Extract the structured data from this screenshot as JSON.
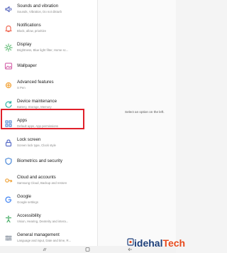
{
  "settings": {
    "items": [
      {
        "title": "Sounds and vibration",
        "subtitle": "Sounds, Vibration, Do not disturb",
        "icon": "speaker-icon",
        "color": "#5c6bc0"
      },
      {
        "title": "Notifications",
        "subtitle": "Block, allow, prioritize",
        "icon": "bell-icon",
        "color": "#ef6c57"
      },
      {
        "title": "Display",
        "subtitle": "Brightness, Blue light filter, Home sc...",
        "icon": "sun-icon",
        "color": "#58b86e"
      },
      {
        "title": "Wallpaper",
        "subtitle": "",
        "icon": "image-icon",
        "color": "#d86fb0"
      },
      {
        "title": "Advanced features",
        "subtitle": "S Pen",
        "icon": "gear-plus-icon",
        "color": "#f2a33a"
      },
      {
        "title": "Device maintenance",
        "subtitle": "Battery, Storage, Memory",
        "icon": "refresh-icon",
        "color": "#35b6a8"
      },
      {
        "title": "Apps",
        "subtitle": "Default apps, App permissions",
        "icon": "apps-grid-icon",
        "color": "#5c8fd6"
      },
      {
        "title": "Lock screen",
        "subtitle": "Screen lock type, Clock style",
        "icon": "lock-icon",
        "color": "#5a6ec7"
      },
      {
        "title": "Biometrics and security",
        "subtitle": "",
        "icon": "shield-icon",
        "color": "#4a88d8"
      },
      {
        "title": "Cloud and accounts",
        "subtitle": "Samsung Cloud, Backup and restore",
        "icon": "key-icon",
        "color": "#f0a43b"
      },
      {
        "title": "Google",
        "subtitle": "Google settings",
        "icon": "google-icon",
        "color": "#4285f4"
      },
      {
        "title": "Accessibility",
        "subtitle": "Vision, Hearing, Dexterity and intera...",
        "icon": "accessibility-icon",
        "color": "#4caf6a"
      },
      {
        "title": "General management",
        "subtitle": "Language and input, Date and time, R...",
        "icon": "sliders-icon",
        "color": "#7a8593"
      }
    ]
  },
  "detail": {
    "message": "Select an option on the left."
  },
  "highlight": {
    "color": "#e0202a",
    "target": "Apps"
  },
  "navbar": {
    "buttons": [
      "recents-icon",
      "home-icon",
      "back-icon"
    ]
  },
  "watermark": {
    "text_a": "idehal",
    "text_b": "Tech"
  }
}
